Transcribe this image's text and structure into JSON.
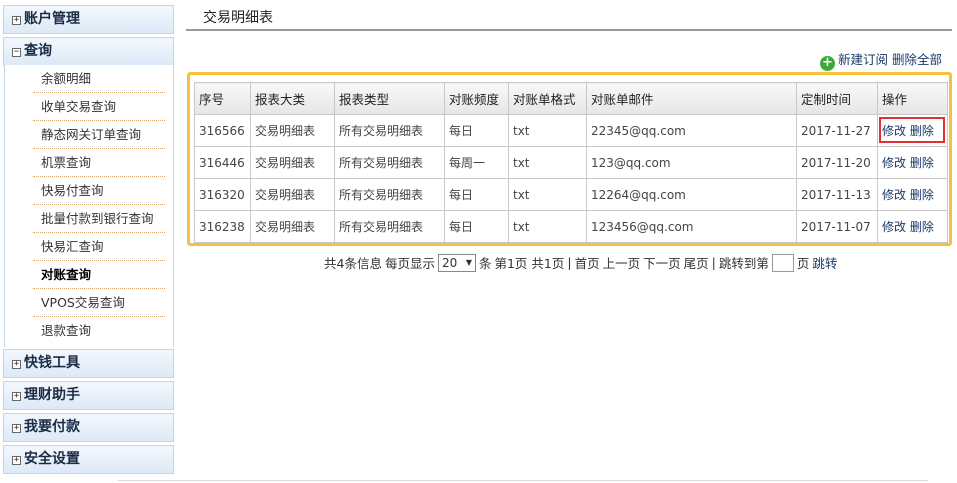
{
  "sidebar": {
    "sections": [
      {
        "label": "账户管理",
        "toggle": "⊞"
      },
      {
        "label": "查询",
        "toggle": "⊟"
      },
      {
        "label": "快钱工具",
        "toggle": "⊞"
      },
      {
        "label": "理财助手",
        "toggle": "⊞"
      },
      {
        "label": "我要付款",
        "toggle": "⊞"
      },
      {
        "label": "安全设置",
        "toggle": "⊞"
      }
    ],
    "query_items": [
      "余额明细",
      "收单交易查询",
      "静态网关订单查询",
      "机票查询",
      "快易付查询",
      "批量付款到银行查询",
      "快易汇查询",
      "对账查询",
      "VPOS交易查询",
      "退款查询"
    ],
    "active_item": "对账查询"
  },
  "main": {
    "title": "交易明细表",
    "actions": {
      "new_subscription": "新建订阅",
      "delete_all": "删除全部"
    },
    "table": {
      "headers": [
        "序号",
        "报表大类",
        "报表类型",
        "对账频度",
        "对账单格式",
        "对账单邮件",
        "定制时间",
        "操作"
      ],
      "rows": [
        {
          "id": "316566",
          "category": "交易明细表",
          "type": "所有交易明细表",
          "frequency": "每日",
          "format": "txt",
          "email": "22345@qq.com",
          "date": "2017-11-27",
          "edit": "修改",
          "delete": "删除"
        },
        {
          "id": "316446",
          "category": "交易明细表",
          "type": "所有交易明细表",
          "frequency": "每周一",
          "format": "txt",
          "email": "123@qq.com",
          "date": "2017-11-20",
          "edit": "修改",
          "delete": "删除"
        },
        {
          "id": "316320",
          "category": "交易明细表",
          "type": "所有交易明细表",
          "frequency": "每日",
          "format": "txt",
          "email": "12264@qq.com",
          "date": "2017-11-13",
          "edit": "修改",
          "delete": "删除"
        },
        {
          "id": "316238",
          "category": "交易明细表",
          "type": "所有交易明细表",
          "frequency": "每日",
          "format": "txt",
          "email": "123456@qq.com",
          "date": "2017-11-07",
          "edit": "修改",
          "delete": "删除"
        }
      ]
    },
    "pagination": {
      "total_text": "共4条信息",
      "per_page_label": "每页显示",
      "per_page_value": "20",
      "unit": "条",
      "page_info": "第1页 共1页",
      "first": "首页",
      "prev": "上一页",
      "next": "下一页",
      "last": "尾页",
      "jump_label": "跳转到第",
      "page_unit": "页",
      "jump_button": "跳转"
    }
  },
  "colors": {
    "frame": "#f6c23e",
    "highlight": "#e03030",
    "accent_green": "#3fa83a",
    "link": "#1a3a6a"
  }
}
